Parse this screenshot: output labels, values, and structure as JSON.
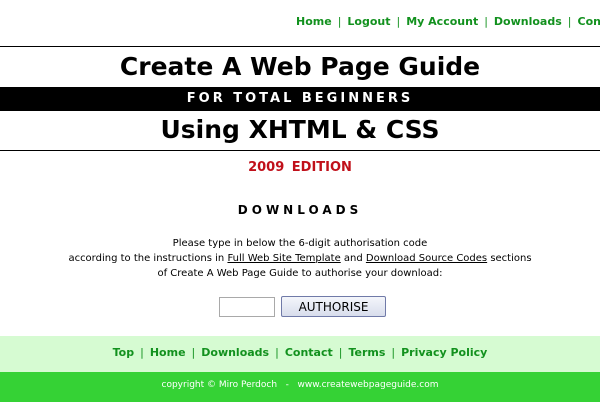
{
  "top_nav": {
    "items": [
      "Home",
      "Logout",
      "My Account",
      "Downloads",
      "Contact"
    ],
    "separator": "|"
  },
  "header": {
    "title": "Create A Web Page Guide",
    "subtitle": "FOR TOTAL BEGINNERS",
    "title2": "Using XHTML & CSS"
  },
  "edition": "2009  EDITION",
  "section_heading": "DOWNLOADS",
  "instructions": {
    "line1": "Please type in below the 6-digit authorisation code",
    "line2_prefix": "according to the instructions in ",
    "link1": "Full Web Site Template",
    "line2_middle": " and ",
    "link2": "Download Source Codes",
    "line2_suffix": " sections",
    "line3": "of Create A Web Page Guide to authorise your download:"
  },
  "auth": {
    "input_value": "",
    "button_label": "AUTHORISE"
  },
  "footer_nav": {
    "items": [
      "Top",
      "Home",
      "Downloads",
      "Contact",
      "Terms",
      "Privacy Policy"
    ],
    "separator": "|"
  },
  "copyright": "copyright © Miro Perdoch   -   www.createwebpageguide.com",
  "colors": {
    "nav_green": "#12911e",
    "edition_red": "#c0101a",
    "footer_light_green": "#d6fbd2",
    "footer_bright_green": "#35d235"
  }
}
